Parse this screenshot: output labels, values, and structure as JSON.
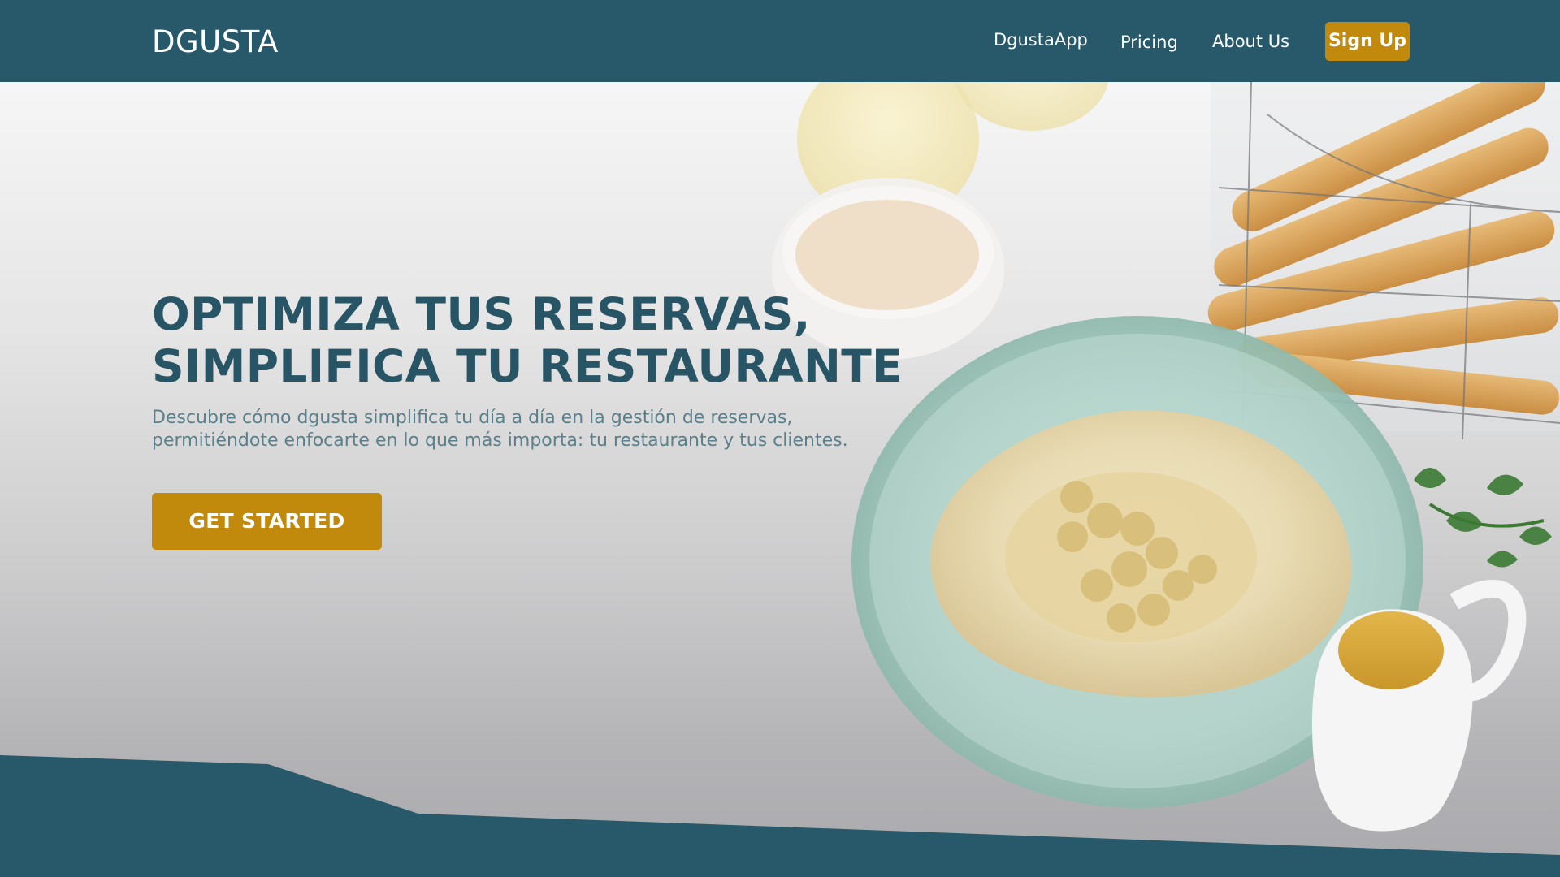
{
  "header": {
    "logo": "DGUSTA",
    "nav": {
      "app": "DgustaApp",
      "pricing": "Pricing",
      "about": "About Us"
    },
    "signup_label": "Sign Up"
  },
  "hero": {
    "headline_line1": "OPTIMIZA TUS RESERVAS,",
    "headline_line2": "SIMPLIFICA TU RESTAURANTE",
    "subtitle": "Descubre cómo dgusta simplifica tu día a día en la gestión de reservas, permitiéndote enfocarte en lo que más importa: tu restaurante y tus clientes.",
    "cta_label": "GET STARTED"
  },
  "colors": {
    "brand": "#28596a",
    "accent": "#c18a0d",
    "headline": "#285566",
    "subtitle": "#5b7f8b"
  }
}
